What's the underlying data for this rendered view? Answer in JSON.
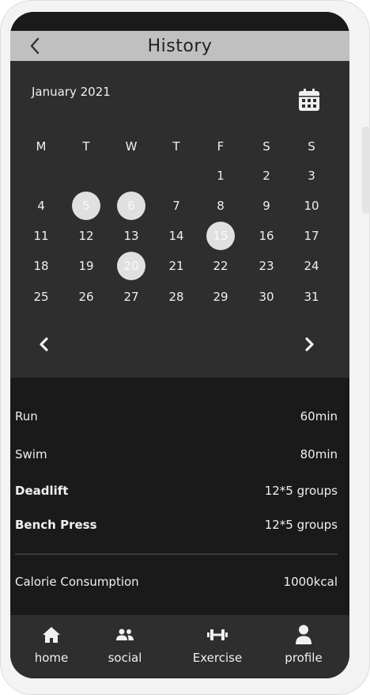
{
  "header": {
    "title": "History"
  },
  "calendar": {
    "month": "January 2021",
    "weekdays": [
      "M",
      "T",
      "W",
      "T",
      "F",
      "S",
      "S"
    ],
    "weeks": [
      [
        "",
        "",
        "",
        "",
        "1",
        "2",
        "3"
      ],
      [
        "4",
        "5",
        "6",
        "7",
        "8",
        "9",
        "10"
      ],
      [
        "11",
        "12",
        "13",
        "14",
        "15",
        "16",
        "17"
      ],
      [
        "18",
        "19",
        "20",
        "21",
        "22",
        "23",
        "24"
      ],
      [
        "25",
        "26",
        "27",
        "28",
        "29",
        "30",
        "31"
      ]
    ],
    "highlighted_days": [
      "5",
      "6",
      "15",
      "20"
    ]
  },
  "history": {
    "items": [
      {
        "name": "Run",
        "value": "60min",
        "bold": false
      },
      {
        "name": "Swim",
        "value": "80min",
        "bold": false
      },
      {
        "name": "Deadlift",
        "value": "12*5 groups",
        "bold": true
      },
      {
        "name": "Bench Press",
        "value": "12*5 groups",
        "bold": true
      }
    ],
    "summary": {
      "label": "Calorie Consumption",
      "value": "1000kcal"
    }
  },
  "tabs": [
    {
      "label": "home",
      "icon": "home-icon"
    },
    {
      "label": "social",
      "icon": "people-icon"
    },
    {
      "label": "Exercise",
      "icon": "dumbbell-icon"
    },
    {
      "label": "profile",
      "icon": "person-icon"
    }
  ],
  "colors": {
    "header_bg": "#c0c0c0",
    "calendar_bg": "#2e2e2e",
    "content_bg": "#1a1a1a",
    "highlight": "#e0e0e0"
  }
}
